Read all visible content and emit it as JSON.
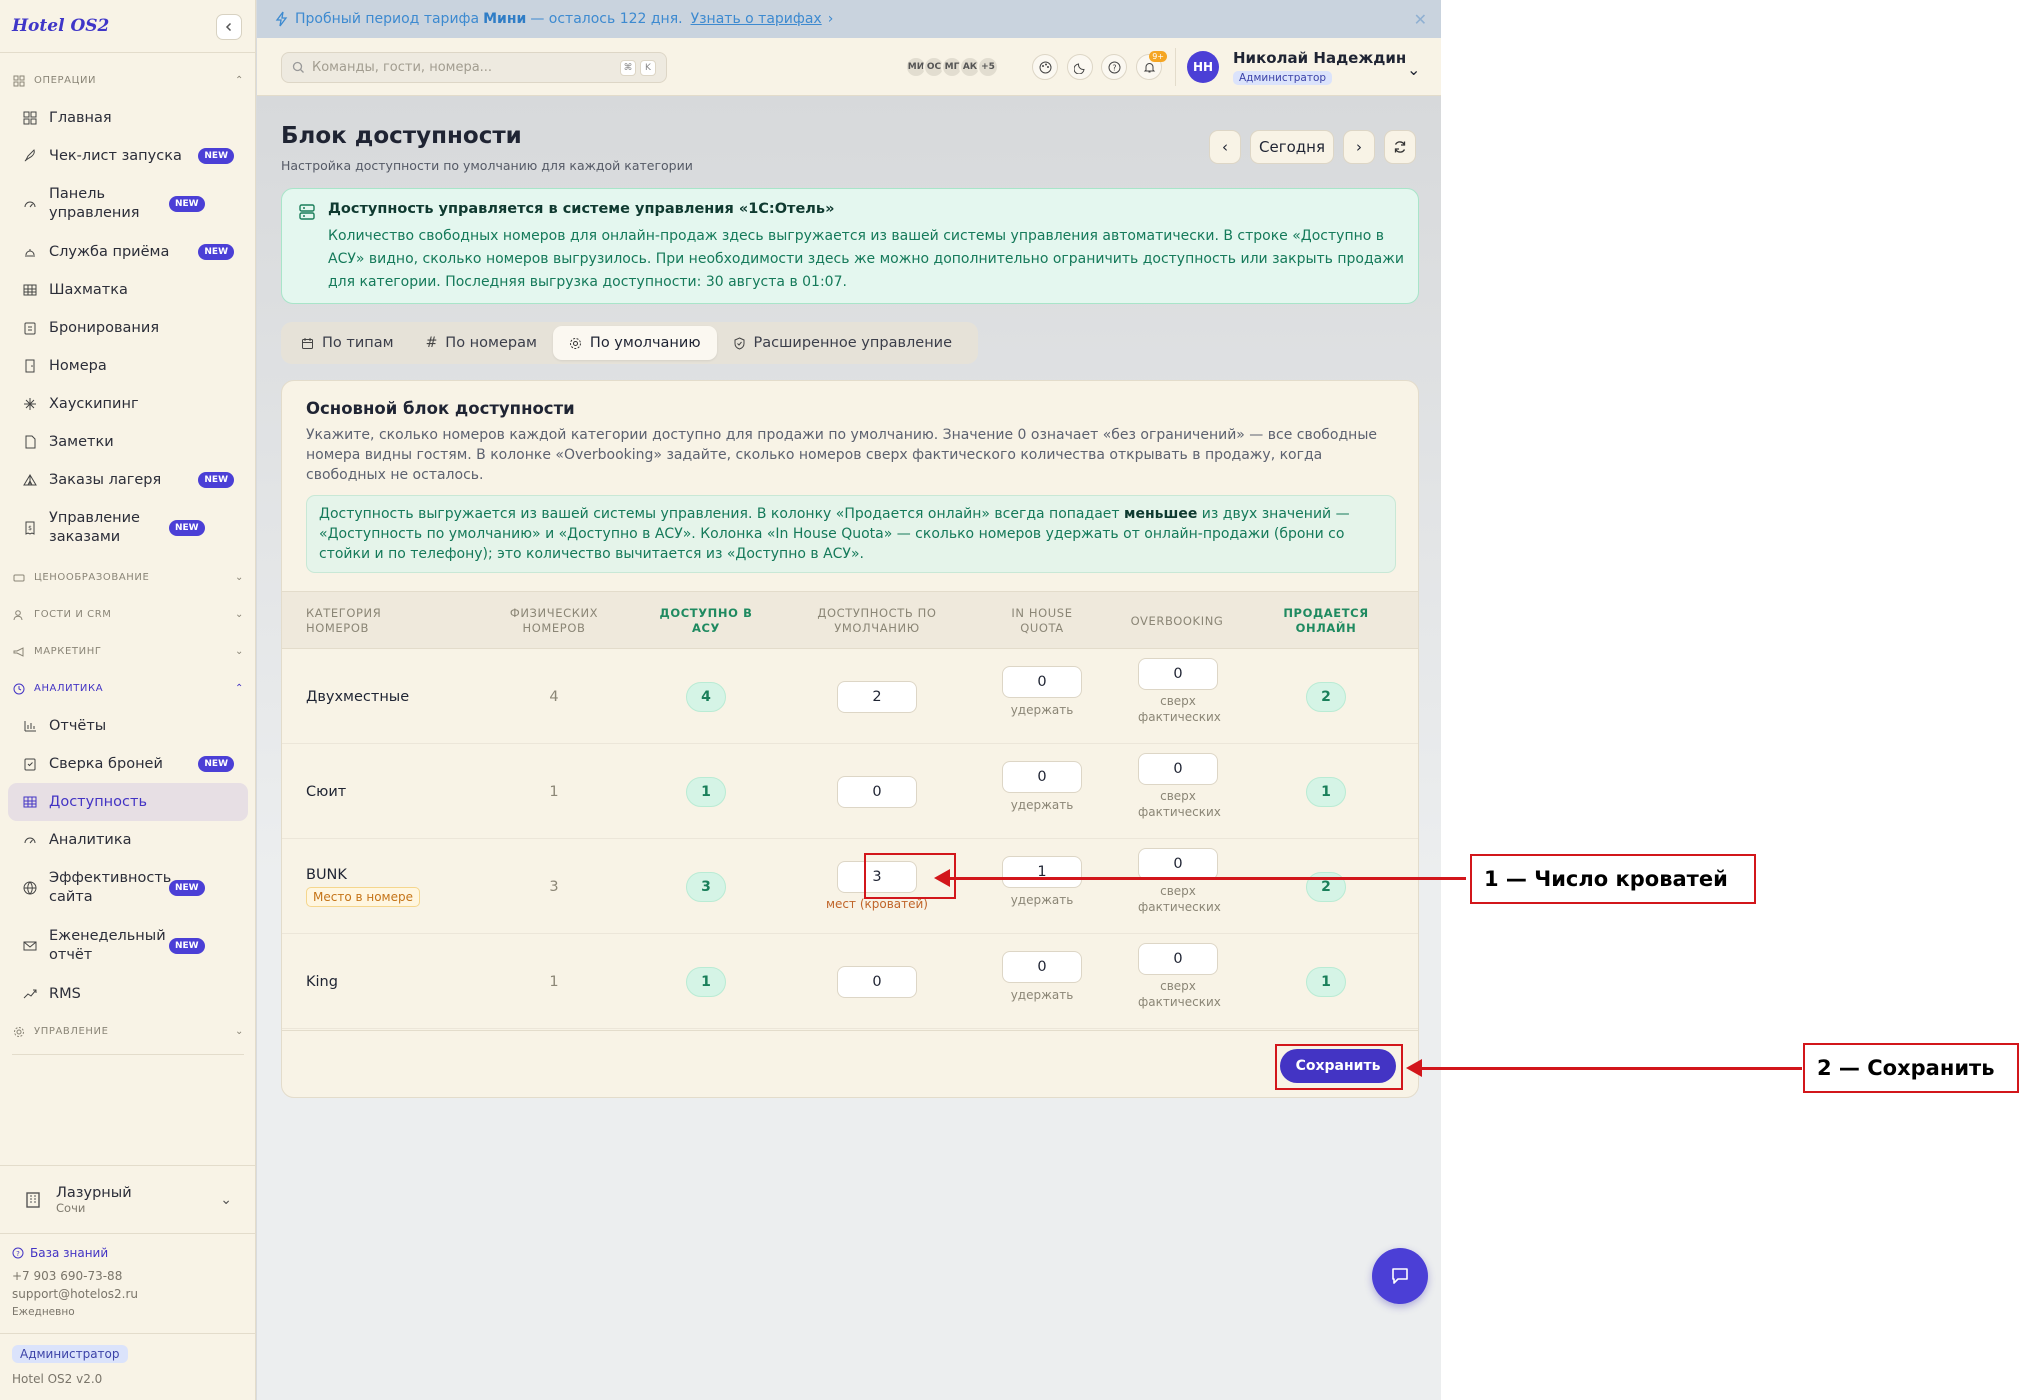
{
  "app": {
    "logo": "Hotel OS2"
  },
  "sidebar": {
    "sections": {
      "operations": "ОПЕРАЦИИ",
      "pricing": "ЦЕНООБРАЗОВАНИЕ",
      "guests": "ГОСТИ И CRM",
      "marketing": "МАРКЕТИНГ",
      "analytics": "АНАЛИТИКА",
      "management": "УПРАВЛЕНИЕ"
    },
    "operations_items": [
      {
        "label": "Главная",
        "badge": "",
        "icon": "grid-icon"
      },
      {
        "label": "Чек-лист запуска",
        "badge": "NEW",
        "icon": "rocket-icon"
      },
      {
        "label": "Панель управления",
        "badge": "NEW",
        "icon": "gauge-icon"
      },
      {
        "label": "Служба приёма",
        "badge": "NEW",
        "icon": "bell-desk-icon"
      },
      {
        "label": "Шахматка",
        "badge": "",
        "icon": "table-icon"
      },
      {
        "label": "Бронирования",
        "badge": "",
        "icon": "clipboard-icon"
      },
      {
        "label": "Номера",
        "badge": "",
        "icon": "door-icon"
      },
      {
        "label": "Хаускипинг",
        "badge": "",
        "icon": "sparkle-icon"
      },
      {
        "label": "Заметки",
        "badge": "",
        "icon": "note-icon"
      },
      {
        "label": "Заказы лагеря",
        "badge": "NEW",
        "icon": "tent-icon"
      },
      {
        "label": "Управление заказами",
        "badge": "NEW",
        "icon": "receipt-icon"
      }
    ],
    "analytics_items": [
      {
        "label": "Отчёты",
        "badge": "",
        "icon": "bar-chart-icon"
      },
      {
        "label": "Сверка броней",
        "badge": "NEW",
        "icon": "clipboard-check-icon"
      },
      {
        "label": "Доступность",
        "badge": "",
        "icon": "table-icon"
      },
      {
        "label": "Аналитика",
        "badge": "",
        "icon": "gauge-icon"
      },
      {
        "label": "Эффективность сайта",
        "badge": "NEW",
        "icon": "globe-icon"
      },
      {
        "label": "Еженедельный отчёт",
        "badge": "NEW",
        "icon": "mail-icon"
      },
      {
        "label": "RMS",
        "badge": "",
        "icon": "trend-icon"
      }
    ],
    "hotel": {
      "name": "Лазурный",
      "city": "Сочи"
    },
    "footer": {
      "knowledge_base": "База знаний",
      "phone": "+7 903 690-73-88",
      "email": "support@hotelos2.ru",
      "schedule": "Ежедневно"
    },
    "role": "Администратор",
    "version": "Hotel OS2 v2.0"
  },
  "banner": {
    "prefix": "Пробный период тарифа",
    "plan": "Мини",
    "suffix": "— осталось 122 дня.",
    "link": "Узнать о тарифах"
  },
  "topbar": {
    "search_placeholder": "Команды, гости, номера...",
    "kbd": [
      "⌘",
      "K"
    ],
    "avatars": [
      "МИ",
      "ОС",
      "МГ",
      "АК",
      "+5"
    ],
    "notif_count": "9+",
    "user": {
      "initials": "НН",
      "name": "Николай Надеждин",
      "role": "Администратор"
    }
  },
  "page": {
    "title": "Блок доступности",
    "subtitle": "Настройка доступности по умолчанию для каждой категории",
    "today_btn": "Сегодня"
  },
  "info": {
    "title": "Доступность управляется в системе управления «1С:Отель»",
    "text": "Количество свободных номеров для онлайн-продаж здесь выгружается из вашей системы управления автоматически. В строке «Доступно в АСУ» видно, сколько номеров выгрузилось. При необходимости здесь же можно дополнительно ограничить доступность или закрыть продажи для категории. Последняя выгрузка доступности: 30 августа в 01:07."
  },
  "tabs": [
    {
      "label": "По типам",
      "icon": "calendar-icon"
    },
    {
      "label": "По номерам",
      "icon": "hash-icon"
    },
    {
      "label": "По умолчанию",
      "icon": "gear-icon"
    },
    {
      "label": "Расширенное управление",
      "icon": "shield-icon"
    }
  ],
  "card": {
    "title": "Основной блок доступности",
    "desc": "Укажите, сколько номеров каждой категории доступно для продажи по умолчанию. Значение 0 означает «без ограничений» — все свободные номера видны гостям. В колонке «Overbooking» задайте, сколько номеров сверх фактического количества открывать в продажу, когда свободных не осталось.",
    "note_a": "Доступность выгружается из вашей системы управления. В колонку «Продается онлайн» всегда попадает ",
    "note_b": "меньшее",
    "note_c": " из двух значений — «Доступность по умолчанию» и «Доступно в АСУ». Колонка «In House Quota» — сколько номеров удержать от онлайн-продажи (брони со стойки и по телефону); это количество вычитается из «Доступно в АСУ».",
    "save": "Сохранить"
  },
  "table": {
    "headers": {
      "category": "КАТЕГОРИЯ НОМЕРОВ",
      "physical": "ФИЗИЧЕСКИХ НОМЕРОВ",
      "asu": "ДОСТУПНО В АСУ",
      "default": "ДОСТУПНОСТЬ ПО УМОЛЧАНИЮ",
      "quota": "IN HOUSE QUOTA",
      "overbooking": "OVERBOOKING",
      "online": "ПРОДАЕТСЯ ОНЛАЙН"
    },
    "hold_label": "удержать",
    "over_label": "сверх фактических",
    "rows": [
      {
        "category": "Двухместные",
        "tag": "",
        "physical": "4",
        "asu": "4",
        "default": "2",
        "default_hint": "",
        "quota": "0",
        "overbooking": "0",
        "online": "2"
      },
      {
        "category": "Сюит",
        "tag": "",
        "physical": "1",
        "asu": "1",
        "default": "0",
        "default_hint": "",
        "quota": "0",
        "overbooking": "0",
        "online": "1"
      },
      {
        "category": "BUNK",
        "tag": "Место в номере",
        "physical": "3",
        "asu": "3",
        "default": "3",
        "default_hint": "мест (кроватей)",
        "quota": "1",
        "overbooking": "0",
        "online": "2"
      },
      {
        "category": "King",
        "tag": "",
        "physical": "1",
        "asu": "1",
        "default": "0",
        "default_hint": "",
        "quota": "0",
        "overbooking": "0",
        "online": "1"
      }
    ]
  },
  "annotations": [
    {
      "label": "1 — Число кроватей"
    },
    {
      "label": "2 — Сохранить"
    }
  ],
  "colors": {
    "accent": "#4334c4",
    "sidebar_bg": "#f8f3e6",
    "green": "#1a7f5a",
    "annotation_red": "#d2161b"
  }
}
